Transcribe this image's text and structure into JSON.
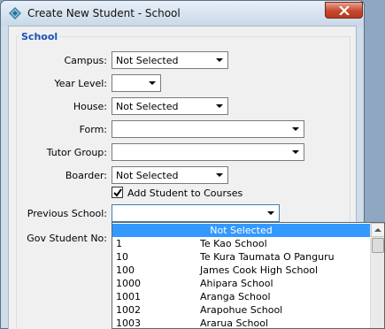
{
  "window": {
    "title": "Create New Student - School"
  },
  "group": {
    "title": "School"
  },
  "form": {
    "campus": {
      "label": "Campus:",
      "value": "Not Selected"
    },
    "year_level": {
      "label": "Year Level:",
      "value": ""
    },
    "house": {
      "label": "House:",
      "value": "Not Selected"
    },
    "form": {
      "label": "Form:",
      "value": ""
    },
    "tutor_group": {
      "label": "Tutor Group:",
      "value": ""
    },
    "boarder": {
      "label": "Boarder:",
      "value": "Not Selected"
    },
    "add_to_courses": {
      "label": "Add Student to Courses",
      "checked": true
    },
    "previous_school": {
      "label": "Previous School:",
      "value": ""
    },
    "gov_student_no": {
      "label": "Gov Student No:",
      "value": ""
    }
  },
  "dropdown": {
    "selected": "Not Selected",
    "items": [
      {
        "code": "1",
        "name": "Te Kao School"
      },
      {
        "code": "10",
        "name": "Te Kura Taumata O Panguru"
      },
      {
        "code": "100",
        "name": "James Cook High School"
      },
      {
        "code": "1000",
        "name": "Ahipara School"
      },
      {
        "code": "1001",
        "name": "Aranga School"
      },
      {
        "code": "1002",
        "name": "Arapohue School"
      },
      {
        "code": "1003",
        "name": "Ararua School"
      }
    ]
  },
  "colors": {
    "group_title": "#1a50b8",
    "selection": "#3399ff",
    "close_button": "#c6472c"
  }
}
